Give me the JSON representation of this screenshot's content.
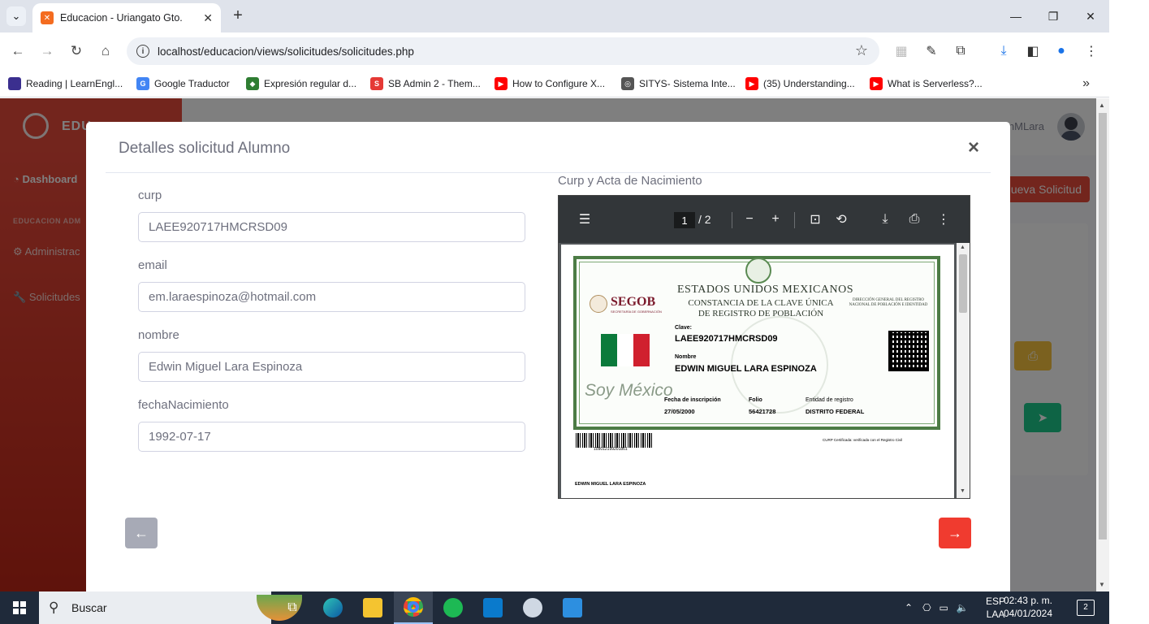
{
  "browser": {
    "tab_title": "Educacion - Uriangato Gto.",
    "url": "localhost/educacion/views/solicitudes/solicitudes.php",
    "bookmarks": [
      {
        "label": "Reading | LearnEngl...",
        "color": "#3b2f8f"
      },
      {
        "label": "Google Traductor",
        "color": "#4285f4"
      },
      {
        "label": "Expresión regular d...",
        "color": "#2e7d32"
      },
      {
        "label": "SB Admin 2 - Them...",
        "color": "#e53935"
      },
      {
        "label": "How to Configure X...",
        "color": "#ff0000"
      },
      {
        "label": "SITYS- Sistema Inte...",
        "color": "#555555"
      },
      {
        "label": "(35) Understanding...",
        "color": "#ff0000"
      },
      {
        "label": "What is Serverless?...",
        "color": "#ff0000"
      }
    ]
  },
  "page": {
    "brand": "EDU",
    "sidebar": {
      "dashboard": "Dashboard",
      "section": "EDUCACION ADM",
      "admin": "Administrac",
      "requests": "Solicitudes"
    },
    "user_name": "EdwinMLara",
    "new_request": "Nueva Solicitud"
  },
  "modal": {
    "title": "Detalles solicitud Alumno",
    "close": "×",
    "fields": [
      {
        "label": "curp",
        "value": "LAEE920717HMCRSD09"
      },
      {
        "label": "email",
        "value": "em.laraespinoza@hotmail.com"
      },
      {
        "label": "nombre",
        "value": "Edwin Miguel Lara Espinoza"
      },
      {
        "label": "fechaNacimiento",
        "value": "1992-07-17"
      }
    ],
    "pdf": {
      "label": "Curp y Acta de Nacimiento",
      "current_page": "1",
      "total_pages": "/ 2",
      "doc": {
        "segob": "SEGOB",
        "segob_sub": "SECRETARÍA DE GOBERNACIÓN",
        "title1": "ESTADOS UNIDOS MEXICANOS",
        "title2": "CONSTANCIA DE LA CLAVE ÚNICA DE REGISTRO DE POBLACIÓN",
        "direccion": "DIRECCIÓN GENERAL DEL REGISTRO NACIONAL DE POBLACIÓN E IDENTIDAD",
        "clave_label": "Clave:",
        "clave": "LAEE920717HMCRSD09",
        "nombre_label": "Nombre",
        "nombre": "EDWIN MIGUEL LARA ESPINOZA",
        "soy_mexico": "Soy México",
        "fecha_label": "Fecha de inscripción",
        "fecha": "27/05/2000",
        "folio_label": "Folio",
        "folio": "56421728",
        "entidad_label": "Entidad de registro",
        "entidad": "DISTRITO FEDERAL",
        "barcode_number": "109012199201861",
        "certificada": "CURP Certificada: verificada con el Registro Civil",
        "footer_name": "EDWIN MIGUEL LARA ESPINOZA"
      }
    }
  },
  "taskbar": {
    "search": "Buscar",
    "lang": "ESP",
    "lang2": "LAA",
    "time": "02:43 p. m.",
    "date": "04/01/2024",
    "notifications": "2"
  },
  "colors": {
    "sidebar": "#e74a3b",
    "next_button": "#f03b2f",
    "prev_button": "#a7aab6"
  }
}
